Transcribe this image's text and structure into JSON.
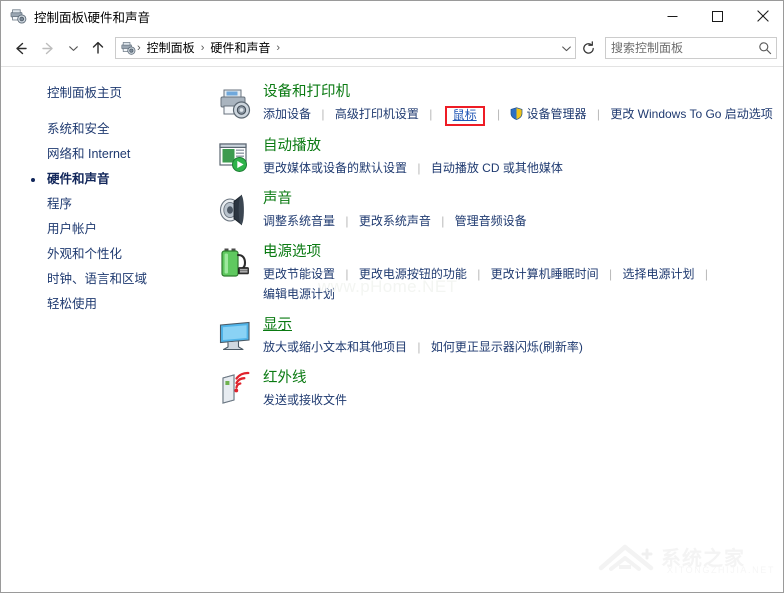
{
  "window": {
    "title": "控制面板\\硬件和声音",
    "title_icon": "devices-and-printers-icon",
    "minimize_label": "最小化",
    "maximize_label": "最大化",
    "close_label": "关闭"
  },
  "nav": {
    "back_label": "后退",
    "forward_label": "前进",
    "recent_label": "最近浏览的位置",
    "up_label": "上移一级",
    "refresh_label": "刷新",
    "breadcrumbs": [
      "控制面板",
      "硬件和声音"
    ],
    "separator": "›"
  },
  "search": {
    "placeholder": "搜索控制面板",
    "value": "",
    "icon": "search-icon"
  },
  "sidebar": {
    "home": "控制面板主页",
    "items": [
      {
        "label": "系统和安全",
        "selected": false
      },
      {
        "label": "网络和 Internet",
        "selected": false
      },
      {
        "label": "硬件和声音",
        "selected": true
      },
      {
        "label": "程序",
        "selected": false
      },
      {
        "label": "用户帐户",
        "selected": false
      },
      {
        "label": "外观和个性化",
        "selected": false
      },
      {
        "label": "时钟、语言和区域",
        "selected": false
      },
      {
        "label": "轻松使用",
        "selected": false
      }
    ]
  },
  "main": {
    "sections": [
      {
        "title": "设备和打印机",
        "icon": "printer-and-camera-icon",
        "links_row1": [
          {
            "text": "添加设备",
            "shield": false,
            "highlight": false
          },
          {
            "text": "高级打印机设置",
            "shield": false,
            "highlight": false
          },
          {
            "text": "鼠标",
            "shield": false,
            "highlight": true
          },
          {
            "text": "设备管理器",
            "shield": true,
            "highlight": false
          },
          {
            "text": "更改 Windows To Go 启动选项",
            "shield": false,
            "highlight": false
          }
        ],
        "links_row2": []
      },
      {
        "title": "自动播放",
        "icon": "autoplay-icon",
        "links_row1": [
          {
            "text": "更改媒体或设备的默认设置",
            "shield": false,
            "highlight": false
          },
          {
            "text": "自动播放 CD 或其他媒体",
            "shield": false,
            "highlight": false
          }
        ],
        "links_row2": []
      },
      {
        "title": "声音",
        "icon": "speaker-icon",
        "links_row1": [
          {
            "text": "调整系统音量",
            "shield": false,
            "highlight": false
          },
          {
            "text": "更改系统声音",
            "shield": false,
            "highlight": false
          },
          {
            "text": "管理音频设备",
            "shield": false,
            "highlight": false
          }
        ],
        "links_row2": []
      },
      {
        "title": "电源选项",
        "icon": "battery-icon",
        "links_row1": [
          {
            "text": "更改节能设置",
            "shield": false,
            "highlight": false
          },
          {
            "text": "更改电源按钮的功能",
            "shield": false,
            "highlight": false
          },
          {
            "text": "更改计算机睡眠时间",
            "shield": false,
            "highlight": false
          },
          {
            "text": "选择电源计划",
            "shield": false,
            "highlight": false
          }
        ],
        "links_row2": [
          {
            "text": "编辑电源计划",
            "shield": false,
            "highlight": false
          }
        ]
      },
      {
        "title": "显示",
        "icon": "monitor-icon",
        "title_underlined": true,
        "links_row1": [
          {
            "text": "放大或缩小文本和其他项目",
            "shield": false,
            "highlight": false
          },
          {
            "text": "如何更正显示器闪烁(刷新率)",
            "shield": false,
            "highlight": false
          }
        ],
        "links_row2": []
      },
      {
        "title": "红外线",
        "icon": "infrared-icon",
        "links_row1": [
          {
            "text": "发送或接收文件",
            "shield": false,
            "highlight": false
          }
        ],
        "links_row2": []
      }
    ]
  },
  "watermarks": {
    "center": "www.pHome.NET",
    "corner_title": "系统之家",
    "corner_sub": "XITONGZHIJIA.NET"
  },
  "colors": {
    "section_title": "#0a7a12",
    "link": "#1f3a70",
    "highlight_box": "#ee1c25",
    "highlight_link": "#2157b5"
  }
}
